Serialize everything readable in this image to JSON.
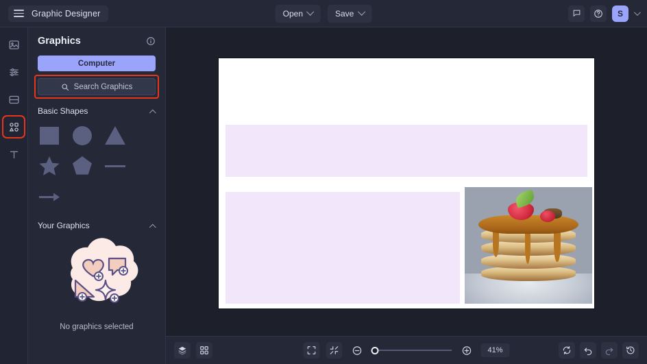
{
  "header": {
    "menu_icon": "hamburger-icon",
    "app_title": "Graphic Designer",
    "open_label": "Open",
    "save_label": "Save",
    "comment_icon": "comment-icon",
    "help_icon": "help-circle-icon",
    "avatar_initial": "S",
    "avatar_color": "#9aa4fb"
  },
  "rail": {
    "items": [
      {
        "name": "images",
        "icon": "image-icon",
        "active": false
      },
      {
        "name": "adjustments",
        "icon": "sliders-icon",
        "active": false
      },
      {
        "name": "layouts",
        "icon": "layout-icon",
        "active": false
      },
      {
        "name": "graphics",
        "icon": "shapes-icon",
        "active": true
      },
      {
        "name": "text",
        "icon": "text-t-icon",
        "active": false
      }
    ],
    "annotation_color": "#e8361b"
  },
  "panel": {
    "title": "Graphics",
    "info_icon": "info-circle-icon",
    "computer_label": "Computer",
    "search_label": "Search Graphics",
    "search_icon": "search-icon",
    "search_annotated": true,
    "sections": [
      {
        "title": "Basic Shapes",
        "collapse_icon": "chevron-up-icon",
        "shapes": [
          {
            "name": "square-shape"
          },
          {
            "name": "circle-shape"
          },
          {
            "name": "triangle-shape"
          },
          {
            "name": "star-shape"
          },
          {
            "name": "pentagon-shape"
          },
          {
            "name": "line-shape"
          },
          {
            "name": "arrow-shape"
          }
        ]
      },
      {
        "title": "Your Graphics",
        "collapse_icon": "chevron-up-icon",
        "empty_caption": "No graphics selected",
        "empty_illustration": "graphics-blob-illustration"
      }
    ],
    "shape_color": "#5b6081"
  },
  "canvas": {
    "background": "#ffffff",
    "placeholder_color": "#f2e6fb",
    "blocks": [
      {
        "name": "placeholder-banner-top"
      },
      {
        "name": "placeholder-block-left"
      },
      {
        "name": "photo-pancakes"
      }
    ]
  },
  "bottombar": {
    "layers_icon": "layers-icon",
    "grid_icon": "grid-icon",
    "fullscreen_icon": "fullscreen-icon",
    "fit_icon": "fit-to-screen-icon",
    "zoom_out_icon": "zoom-out-icon",
    "zoom_in_icon": "zoom-in-icon",
    "zoom_value": "41%",
    "zoom_percent": 41,
    "refresh_icon": "refresh-icon",
    "undo_icon": "undo-icon",
    "redo_icon": "redo-icon",
    "history_icon": "history-icon"
  }
}
